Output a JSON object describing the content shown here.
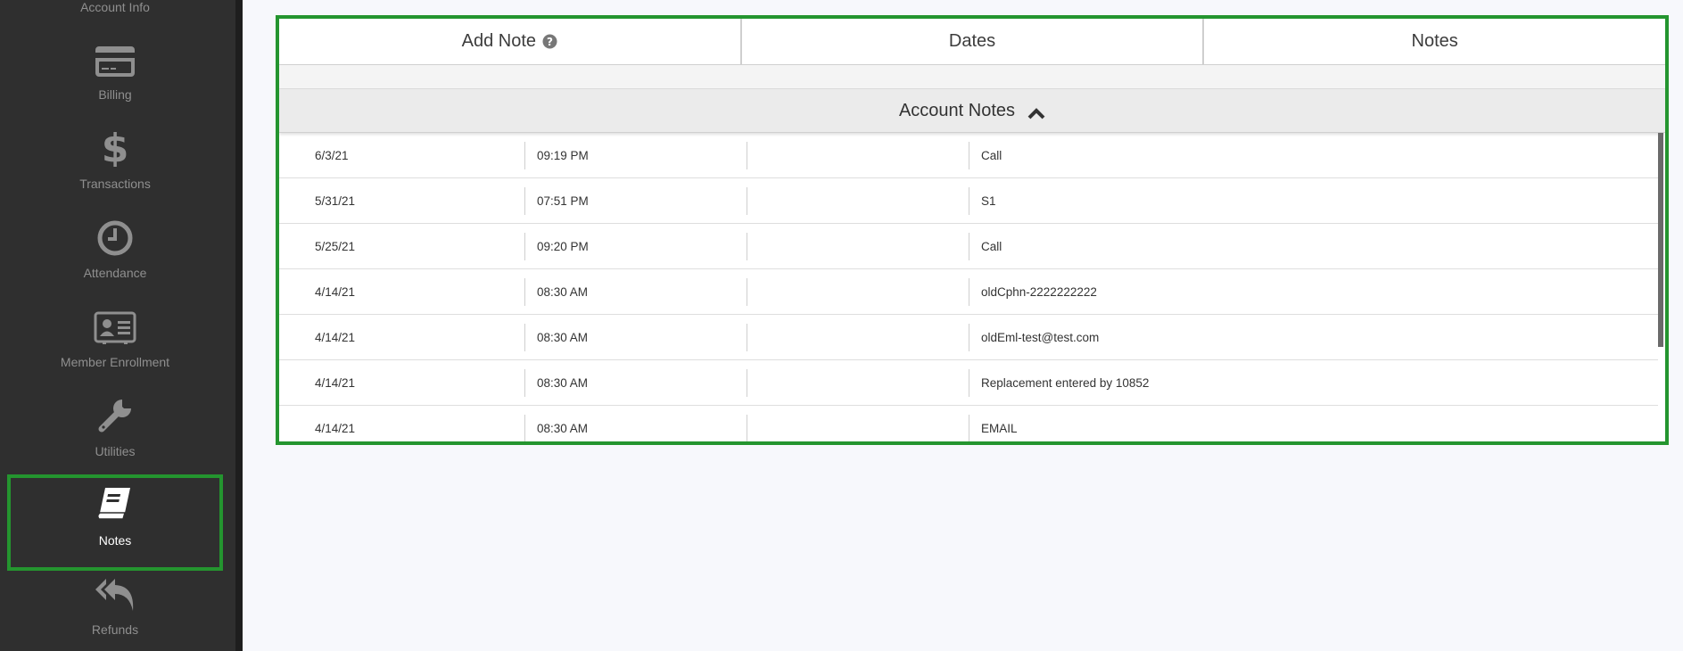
{
  "sidebar": {
    "items": [
      {
        "label": "Account Info",
        "icon": "account-info-icon"
      },
      {
        "label": "Billing",
        "icon": "credit-card-icon"
      },
      {
        "label": "Transactions",
        "icon": "dollar-icon"
      },
      {
        "label": "Attendance",
        "icon": "clock-icon"
      },
      {
        "label": "Member Enrollment",
        "icon": "id-card-icon"
      },
      {
        "label": "Utilities",
        "icon": "wrench-icon"
      },
      {
        "label": "Notes",
        "icon": "book-icon",
        "active": true
      },
      {
        "label": "Refunds",
        "icon": "reply-all-icon"
      }
    ]
  },
  "tabs": [
    {
      "label": "Add Note",
      "icon": "question-circle-icon"
    },
    {
      "label": "Dates"
    },
    {
      "label": "Notes"
    }
  ],
  "section": {
    "title": "Account Notes",
    "icon": "chevron-up-icon"
  },
  "notes": [
    {
      "date": "6/3/21",
      "time": "09:19 PM",
      "extra": "",
      "note": "Call"
    },
    {
      "date": "5/31/21",
      "time": "07:51 PM",
      "extra": "",
      "note": "S1"
    },
    {
      "date": "5/25/21",
      "time": "09:20 PM",
      "extra": "",
      "note": "Call"
    },
    {
      "date": "4/14/21",
      "time": "08:30 AM",
      "extra": "",
      "note": "oldCphn-2222222222"
    },
    {
      "date": "4/14/21",
      "time": "08:30 AM",
      "extra": "",
      "note": "oldEml-test@test.com"
    },
    {
      "date": "4/14/21",
      "time": "08:30 AM",
      "extra": "",
      "note": "Replacement entered by 10852"
    },
    {
      "date": "4/14/21",
      "time": "08:30 AM",
      "extra": "",
      "note": "EMAIL"
    }
  ],
  "colors": {
    "sidebar_bg": "#2f2f2f",
    "highlight": "#24952f",
    "page_bg": "#f7f8fc"
  }
}
